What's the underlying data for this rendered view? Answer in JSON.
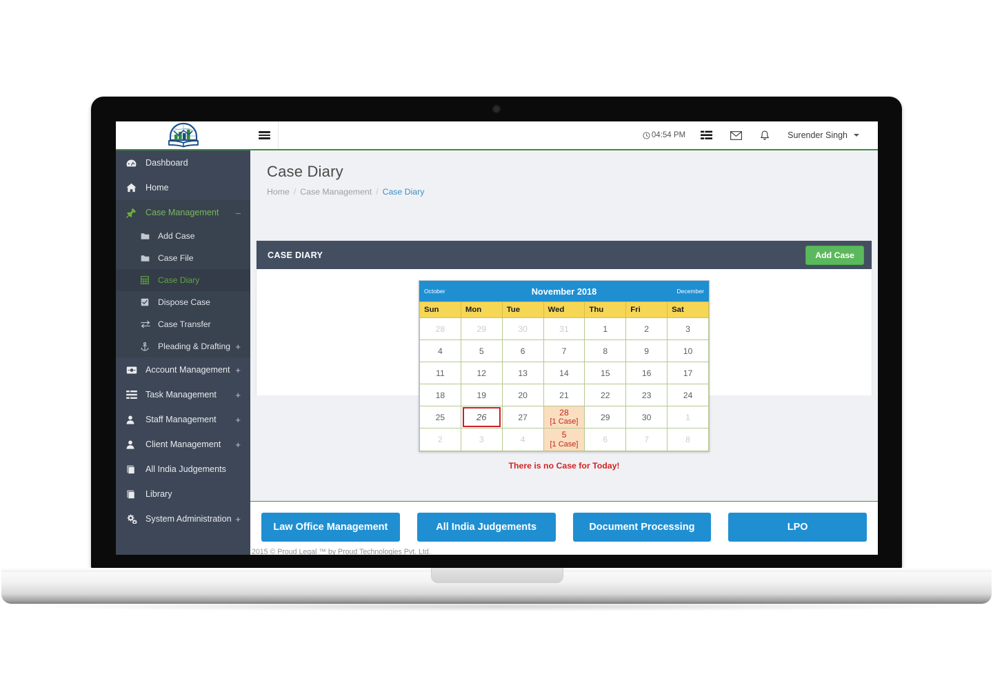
{
  "brand": {
    "logo_icon": "proud-legal-logo"
  },
  "topbar": {
    "menu_toggle_icon": "hamburger-icon",
    "clock_icon": "clock-icon",
    "time": "04:54 PM",
    "tasks_icon": "tasks-list-icon",
    "mail_icon": "envelope-icon",
    "bell_icon": "bell-icon",
    "user_name": "Surender Singh",
    "caret_icon": "chevron-down-icon"
  },
  "sidebar": {
    "items": [
      {
        "label": "Dashboard",
        "icon": "dashboard-icon",
        "expand": ""
      },
      {
        "label": "Home",
        "icon": "home-icon",
        "expand": ""
      },
      {
        "label": "Case Management",
        "icon": "pushpin-icon",
        "expand": "–",
        "active": true
      },
      {
        "label": "Account Management",
        "icon": "money-icon",
        "expand": "+"
      },
      {
        "label": "Task Management",
        "icon": "task-list-icon",
        "expand": "+"
      },
      {
        "label": "Staff Management",
        "icon": "user-icon",
        "expand": "+"
      },
      {
        "label": "Client Management",
        "icon": "user-icon",
        "expand": "+"
      },
      {
        "label": "All India Judgements",
        "icon": "book-icon",
        "expand": ""
      },
      {
        "label": "Library",
        "icon": "book-icon",
        "expand": ""
      },
      {
        "label": "System Administration",
        "icon": "gears-icon",
        "expand": "+"
      }
    ],
    "submenu": [
      {
        "label": "Add Case",
        "icon": "folder-icon",
        "expand": ""
      },
      {
        "label": "Case File",
        "icon": "folder-icon",
        "expand": ""
      },
      {
        "label": "Case Diary",
        "icon": "table-grid-icon",
        "expand": "",
        "active": true
      },
      {
        "label": "Dispose Case",
        "icon": "check-square-icon",
        "expand": ""
      },
      {
        "label": "Case Transfer",
        "icon": "exchange-arrows-icon",
        "expand": ""
      },
      {
        "label": "Pleading & Drafting",
        "icon": "anchor-icon",
        "expand": "+"
      }
    ]
  },
  "page": {
    "title": "Case Diary",
    "breadcrumb": [
      {
        "label": "Home",
        "active": false
      },
      {
        "label": "Case Management",
        "active": false
      },
      {
        "label": "Case Diary",
        "active": true
      }
    ]
  },
  "panel": {
    "title": "CASE DIARY",
    "add_case_label": "Add Case"
  },
  "calendar": {
    "prev_month": "October",
    "title": "November 2018",
    "next_month": "December",
    "weekdays": [
      "Sun",
      "Mon",
      "Tue",
      "Wed",
      "Thu",
      "Fri",
      "Sat"
    ],
    "weeks": [
      [
        {
          "day": "28",
          "state": "muted"
        },
        {
          "day": "29",
          "state": "muted"
        },
        {
          "day": "30",
          "state": "muted"
        },
        {
          "day": "31",
          "state": "muted"
        },
        {
          "day": "1",
          "state": "normal"
        },
        {
          "day": "2",
          "state": "normal"
        },
        {
          "day": "3",
          "state": "normal"
        }
      ],
      [
        {
          "day": "4",
          "state": "normal"
        },
        {
          "day": "5",
          "state": "normal"
        },
        {
          "day": "6",
          "state": "normal"
        },
        {
          "day": "7",
          "state": "normal"
        },
        {
          "day": "8",
          "state": "normal"
        },
        {
          "day": "9",
          "state": "normal"
        },
        {
          "day": "10",
          "state": "normal"
        }
      ],
      [
        {
          "day": "11",
          "state": "normal"
        },
        {
          "day": "12",
          "state": "normal"
        },
        {
          "day": "13",
          "state": "normal"
        },
        {
          "day": "14",
          "state": "normal"
        },
        {
          "day": "15",
          "state": "normal"
        },
        {
          "day": "16",
          "state": "normal"
        },
        {
          "day": "17",
          "state": "normal"
        }
      ],
      [
        {
          "day": "18",
          "state": "normal"
        },
        {
          "day": "19",
          "state": "normal"
        },
        {
          "day": "20",
          "state": "normal"
        },
        {
          "day": "21",
          "state": "normal"
        },
        {
          "day": "22",
          "state": "normal"
        },
        {
          "day": "23",
          "state": "normal"
        },
        {
          "day": "24",
          "state": "normal"
        }
      ],
      [
        {
          "day": "25",
          "state": "normal"
        },
        {
          "day": "26",
          "state": "today"
        },
        {
          "day": "27",
          "state": "normal"
        },
        {
          "day": "28",
          "state": "has-case",
          "cases": "[1 Case]"
        },
        {
          "day": "29",
          "state": "normal"
        },
        {
          "day": "30",
          "state": "normal"
        },
        {
          "day": "1",
          "state": "muted"
        }
      ],
      [
        {
          "day": "2",
          "state": "muted"
        },
        {
          "day": "3",
          "state": "muted"
        },
        {
          "day": "4",
          "state": "muted"
        },
        {
          "day": "5",
          "state": "has-case",
          "cases": "[1 Case]"
        },
        {
          "day": "6",
          "state": "muted"
        },
        {
          "day": "7",
          "state": "muted"
        },
        {
          "day": "8",
          "state": "muted"
        }
      ]
    ],
    "no_case_message": "There is no Case for Today!"
  },
  "footer": {
    "buttons": [
      {
        "label": "Law Office Management"
      },
      {
        "label": "All India Judgements"
      },
      {
        "label": "Document Processing"
      },
      {
        "label": "LPO"
      }
    ],
    "copyright": "2015 © Proud Legal ™ by Proud Technologies Pvt. Ltd."
  },
  "colors": {
    "sidebar_bg": "#3d4757",
    "accent_green": "#5cb85c",
    "accent_blue": "#1f8fd2",
    "calendar_header": "#1f8fd2",
    "weekday_bg": "#f6d655",
    "case_cell_bg": "#fbddc0",
    "case_text": "#b82c1c",
    "today_border": "#c8202a",
    "panel_header": "#434e60",
    "alert_red": "#d62222"
  }
}
